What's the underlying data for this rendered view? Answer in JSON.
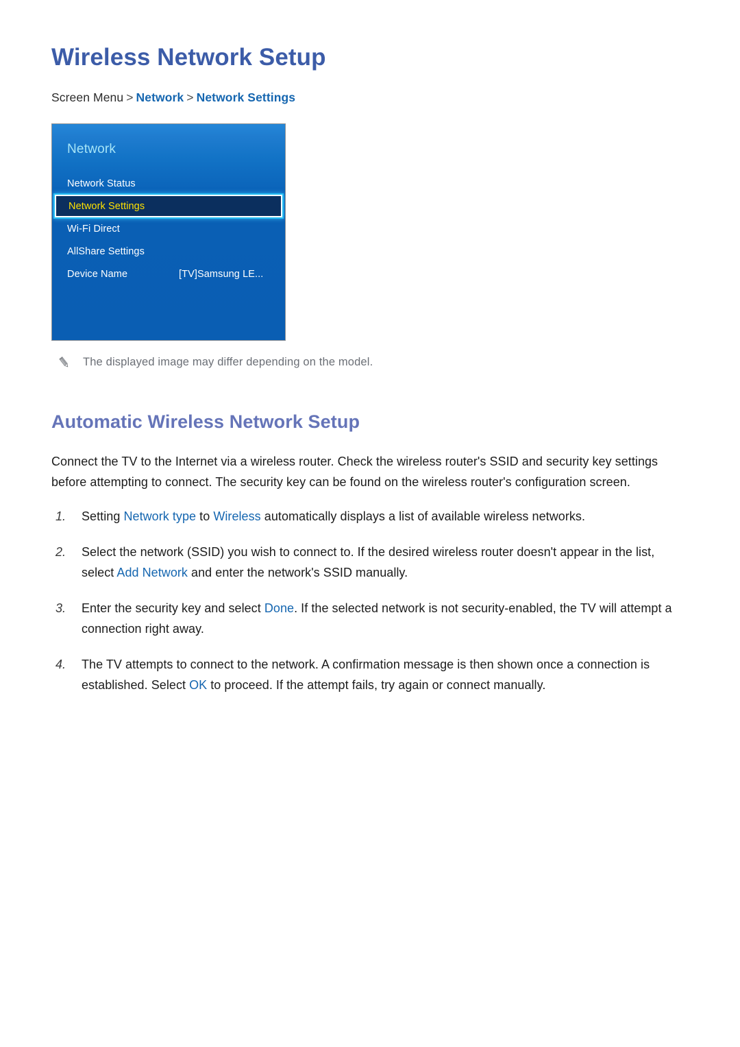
{
  "document": {
    "title": "Wireless Network Setup"
  },
  "breadcrumb": {
    "root": "Screen Menu",
    "separator": ">",
    "level1": "Network",
    "level2": "Network Settings"
  },
  "tv_menu": {
    "header": "Network",
    "selected_index": 1,
    "colors": {
      "panel_top": "#2487d8",
      "panel_bottom": "#0a5eb3",
      "header_text": "#a5e4f7",
      "item_text": "#ffffff",
      "selected_bg": "#0b2f5e",
      "selected_text": "#ffe100",
      "selected_glow": "#27c0f5"
    },
    "items": [
      {
        "label": "Network Status",
        "value": ""
      },
      {
        "label": "Network Settings",
        "value": ""
      },
      {
        "label": "Wi-Fi Direct",
        "value": ""
      },
      {
        "label": "AllShare Settings",
        "value": ""
      },
      {
        "label": "Device Name",
        "value": "[TV]Samsung LE..."
      }
    ]
  },
  "note": {
    "icon": "pencil-icon",
    "text": "The displayed image may differ depending on the model."
  },
  "section": {
    "heading": "Automatic Wireless Network Setup",
    "paragraph": "Connect the TV to the Internet via a wireless router. Check the wireless router's SSID and security key settings before attempting to connect. The security key can be found on the wireless router's configuration screen."
  },
  "steps": [
    {
      "number": "1.",
      "parts": [
        {
          "text": "Setting ",
          "highlight": false
        },
        {
          "text": "Network type",
          "highlight": true
        },
        {
          "text": " to ",
          "highlight": false
        },
        {
          "text": "Wireless",
          "highlight": true
        },
        {
          "text": " automatically displays a list of available wireless networks.",
          "highlight": false
        }
      ]
    },
    {
      "number": "2.",
      "parts": [
        {
          "text": "Select the network (SSID) you wish to connect to. If the desired wireless router doesn't appear in the list, select ",
          "highlight": false
        },
        {
          "text": "Add Network",
          "highlight": true
        },
        {
          "text": " and enter the network's SSID manually.",
          "highlight": false
        }
      ]
    },
    {
      "number": "3.",
      "parts": [
        {
          "text": "Enter the security key and select ",
          "highlight": false
        },
        {
          "text": "Done",
          "highlight": true
        },
        {
          "text": ". If the selected network is not security-enabled, the TV will attempt a connection right away.",
          "highlight": false
        }
      ]
    },
    {
      "number": "4.",
      "parts": [
        {
          "text": "The TV attempts to connect to the network. A confirmation message is then shown once a connection is established. Select ",
          "highlight": false
        },
        {
          "text": "OK",
          "highlight": true
        },
        {
          "text": " to proceed. If the attempt fails, try again or connect manually.",
          "highlight": false
        }
      ]
    }
  ],
  "theme": {
    "title_color": "#3c5ca8",
    "section_color": "#6574b8",
    "link_color": "#1566b0",
    "body_color": "#1c1c1c",
    "note_color": "#6b6f76"
  }
}
